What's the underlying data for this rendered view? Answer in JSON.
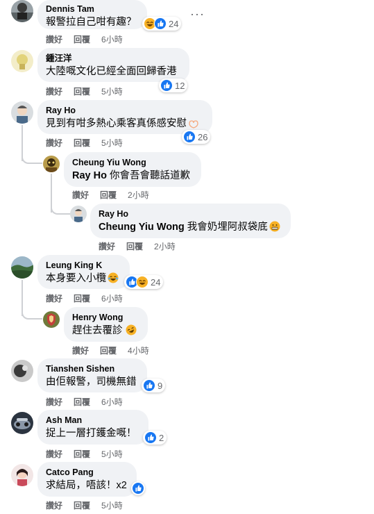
{
  "labels": {
    "like": "讚好",
    "reply": "回覆"
  },
  "comments": [
    {
      "name": "Dennis Tam",
      "text": "報警拉自己咁有趣？",
      "time": "6小時",
      "reactions": "24"
    },
    {
      "name": "鍾汪洋",
      "text": "大陸嘅文化已經全面回歸香港",
      "time": "5小時",
      "reactions": "12"
    },
    {
      "name": "Ray Ho",
      "text": "見到有咁多熱心乘客真係感安慰",
      "time": "5小時",
      "reactions": "26"
    },
    {
      "name": "Cheung Yiu Wong",
      "mention": "Ray Ho",
      "text": " 你會吾會聽話道歉",
      "time": "2小時"
    },
    {
      "name": "Ray Ho",
      "mention": "Cheung Yiu Wong",
      "text": " 我會奶埋阿叔袋底",
      "time": "2小時"
    },
    {
      "name": "Leung King K",
      "text": "本身要入小欖",
      "time": "6小時",
      "reactions": "24"
    },
    {
      "name": "Henry Wong",
      "text": "趕住去覆診",
      "time": "4小時"
    },
    {
      "name": "Tianshen Sishen",
      "text": "由佢報警，司機無錯",
      "time": "6小時",
      "reactions": "9"
    },
    {
      "name": "Ash Man",
      "text": "捉上一層打鑊金嘅！",
      "time": "5小時",
      "reactions": "2"
    },
    {
      "name": "Catco Pang",
      "text": "求結局，唔該！x2",
      "time": "5小時"
    }
  ],
  "more_menu_icon": "more-horizontal-icon",
  "colors": {
    "like_blue": "#1877f2",
    "haha_yellow": "#f7b125",
    "bubble": "#f0f2f5",
    "meta": "#65676b"
  }
}
